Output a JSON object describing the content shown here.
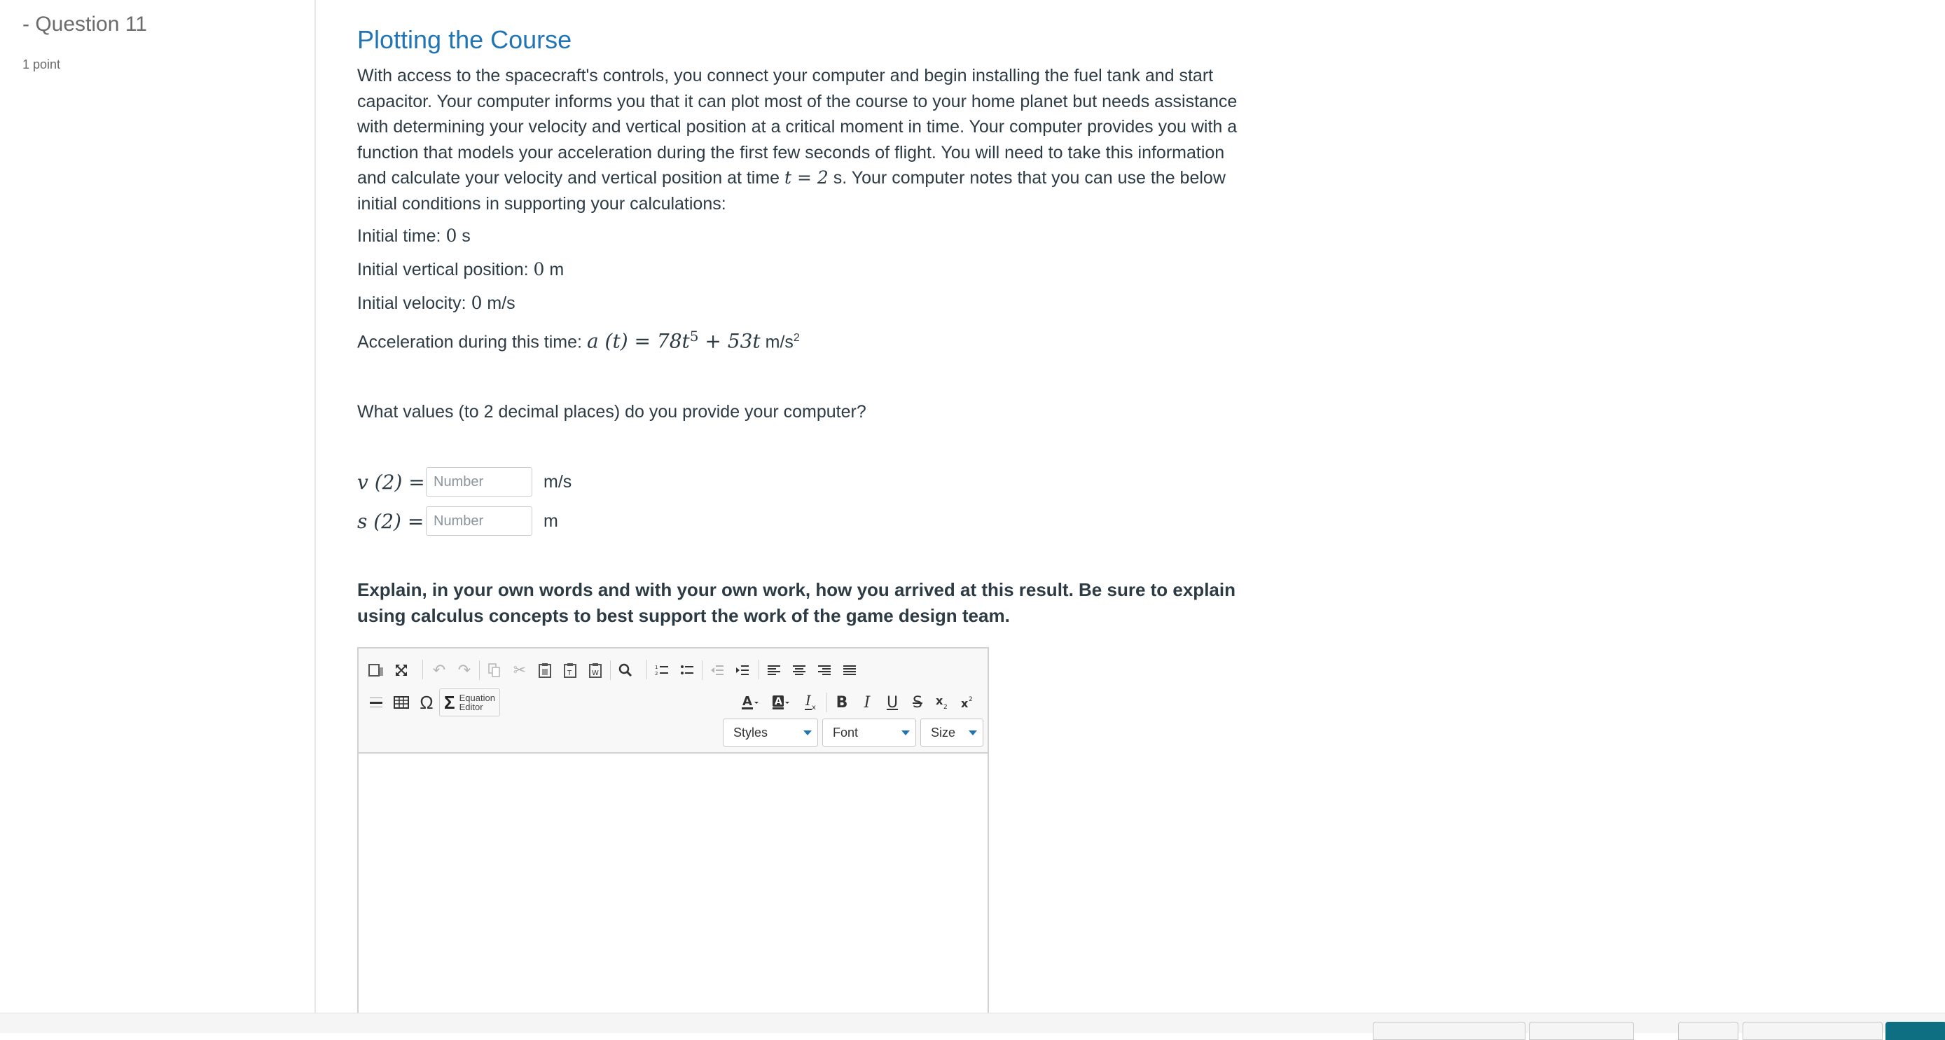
{
  "sidebar": {
    "question_title": "- Question 11",
    "points": "1 point"
  },
  "question": {
    "heading": "Plotting the Course",
    "intro_part1": "With access to the spacecraft's controls, you connect your computer and begin installing the fuel tank and start capacitor. Your computer informs you that it can plot most of the course to your home planet but needs assistance with determining your velocity and vertical position at a critical moment in time. Your computer provides you with a function that models your acceleration during the first few seconds of flight. You will need to take this information and calculate your velocity and vertical position at time ",
    "intro_math": "t = 2",
    "intro_part2": " s. Your computer notes that you can use the below initial conditions in supporting your calculations:",
    "initial_time_label": "Initial time: ",
    "initial_time_value": "0",
    "initial_time_unit": " s",
    "initial_position_label": "Initial vertical position: ",
    "initial_position_value": "0",
    "initial_position_unit": " m",
    "initial_velocity_label": "Initial velocity: ",
    "initial_velocity_value": "0",
    "initial_velocity_unit": " m/s",
    "acceleration_label": "Acceleration during this time: ",
    "acceleration_lhs": "a (t) = 78t",
    "acceleration_exp": "5",
    "acceleration_rhs": " + 53t",
    "acceleration_unit": " m/s",
    "acceleration_unit_exp": "2",
    "prompt": "What values (to 2 decimal places) do you provide your computer?",
    "answers": [
      {
        "lhs": "v (2) =",
        "placeholder": "Number",
        "unit": "m/s"
      },
      {
        "lhs": "s (2) =",
        "placeholder": "Number",
        "unit": "m"
      }
    ],
    "explain": "Explain, in your own words and with your own work, how you arrived at this result. Be sure to explain using calculus concepts to best support the work of the game design team."
  },
  "editor": {
    "equation_editor_label_1": "Equation",
    "equation_editor_label_2": "Editor",
    "styles_label": "Styles",
    "font_label": "Font",
    "size_label": "Size",
    "row1_icons": [
      "source-icon",
      "maximize-icon",
      "undo-icon",
      "redo-icon",
      "copy-icon",
      "cut-icon",
      "paste-icon",
      "paste-text-icon",
      "paste-word-icon",
      "find-icon",
      "numbered-list-icon",
      "bulleted-list-icon",
      "outdent-icon",
      "indent-icon",
      "align-left-icon",
      "align-center-icon",
      "align-right-icon",
      "justify-icon"
    ],
    "row2_icons": [
      "horizontal-rule-icon",
      "table-icon",
      "special-char-icon",
      "equation-icon",
      "text-color-icon",
      "bg-color-icon",
      "remove-format-icon",
      "bold-icon",
      "italic-icon",
      "underline-icon",
      "strike-icon",
      "subscript-icon",
      "superscript-icon"
    ]
  },
  "colors": {
    "accent": "#2275b3",
    "text": "#2d3b45",
    "primary_button": "#0e6e82"
  }
}
